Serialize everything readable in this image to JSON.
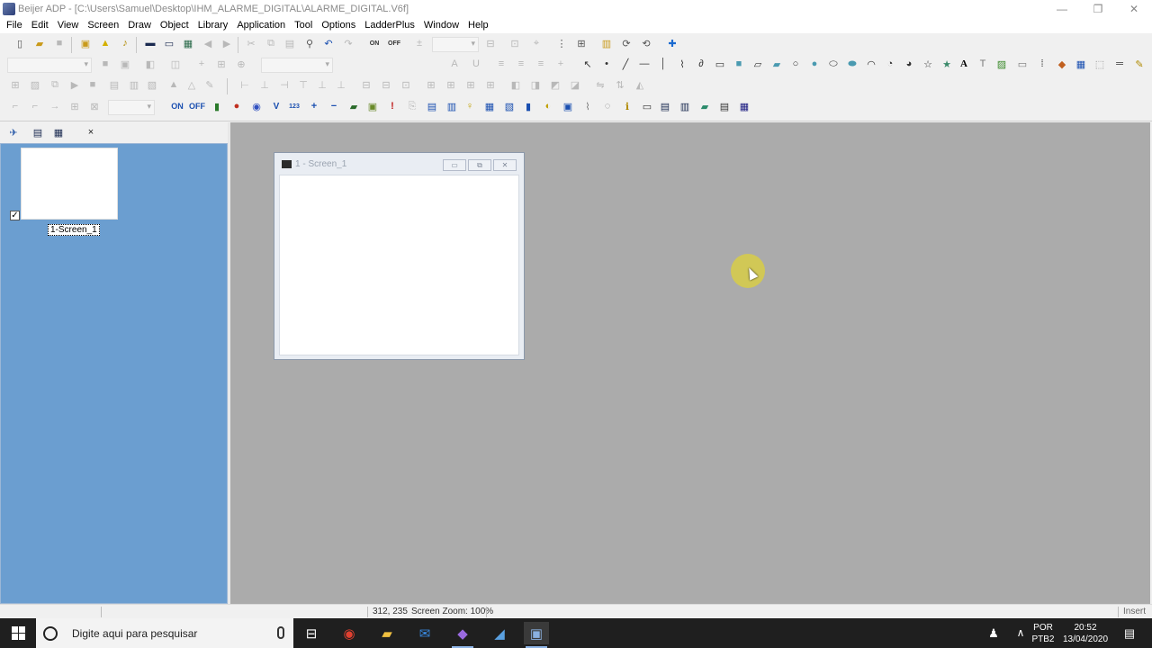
{
  "window": {
    "title": "Beijer ADP - [C:\\Users\\Samuel\\Desktop\\IHM_ALARME_DIGITAL\\ALARME_DIGITAL.V6f]",
    "minimize_glyph": "—",
    "maximize_glyph": "❐",
    "close_glyph": "✕"
  },
  "menu": [
    "File",
    "Edit",
    "View",
    "Screen",
    "Draw",
    "Object",
    "Library",
    "Application",
    "Tool",
    "Options",
    "LadderPlus",
    "Window",
    "Help"
  ],
  "toolbar": {
    "on_label": "ON",
    "off_label": "OFF",
    "on_off_top": "ON",
    "on_off_bottom": "OFF",
    "v_label": "V",
    "num_label": "123",
    "insert_text_label": "A"
  },
  "screens_panel": {
    "items": [
      {
        "label": "1-Screen_1",
        "checked": true,
        "check_glyph": "✓"
      }
    ],
    "background": "#6b9ed0"
  },
  "mdi_window": {
    "title": "1 - Screen_1",
    "minimize_glyph": "▭",
    "restore_glyph": "⧉",
    "close_glyph": "✕"
  },
  "status_bar": {
    "coords": "312, 235",
    "zoom": "Screen Zoom: 100%",
    "mode": "Insert"
  },
  "taskbar": {
    "search_placeholder": "Digite aqui para pesquisar",
    "language_top": "POR",
    "language_bottom": "PTB2",
    "time": "20:52",
    "date": "13/04/2020",
    "apps": [
      "task-view",
      "chrome",
      "file-explorer",
      "mail",
      "visual-studio",
      "app-blue",
      "beijer-adp"
    ]
  },
  "colors": {
    "workspace": "#ababab",
    "panel": "#6b9ed0",
    "taskbar": "#1f1f1f",
    "cursor_highlight": "#d7cd46"
  }
}
